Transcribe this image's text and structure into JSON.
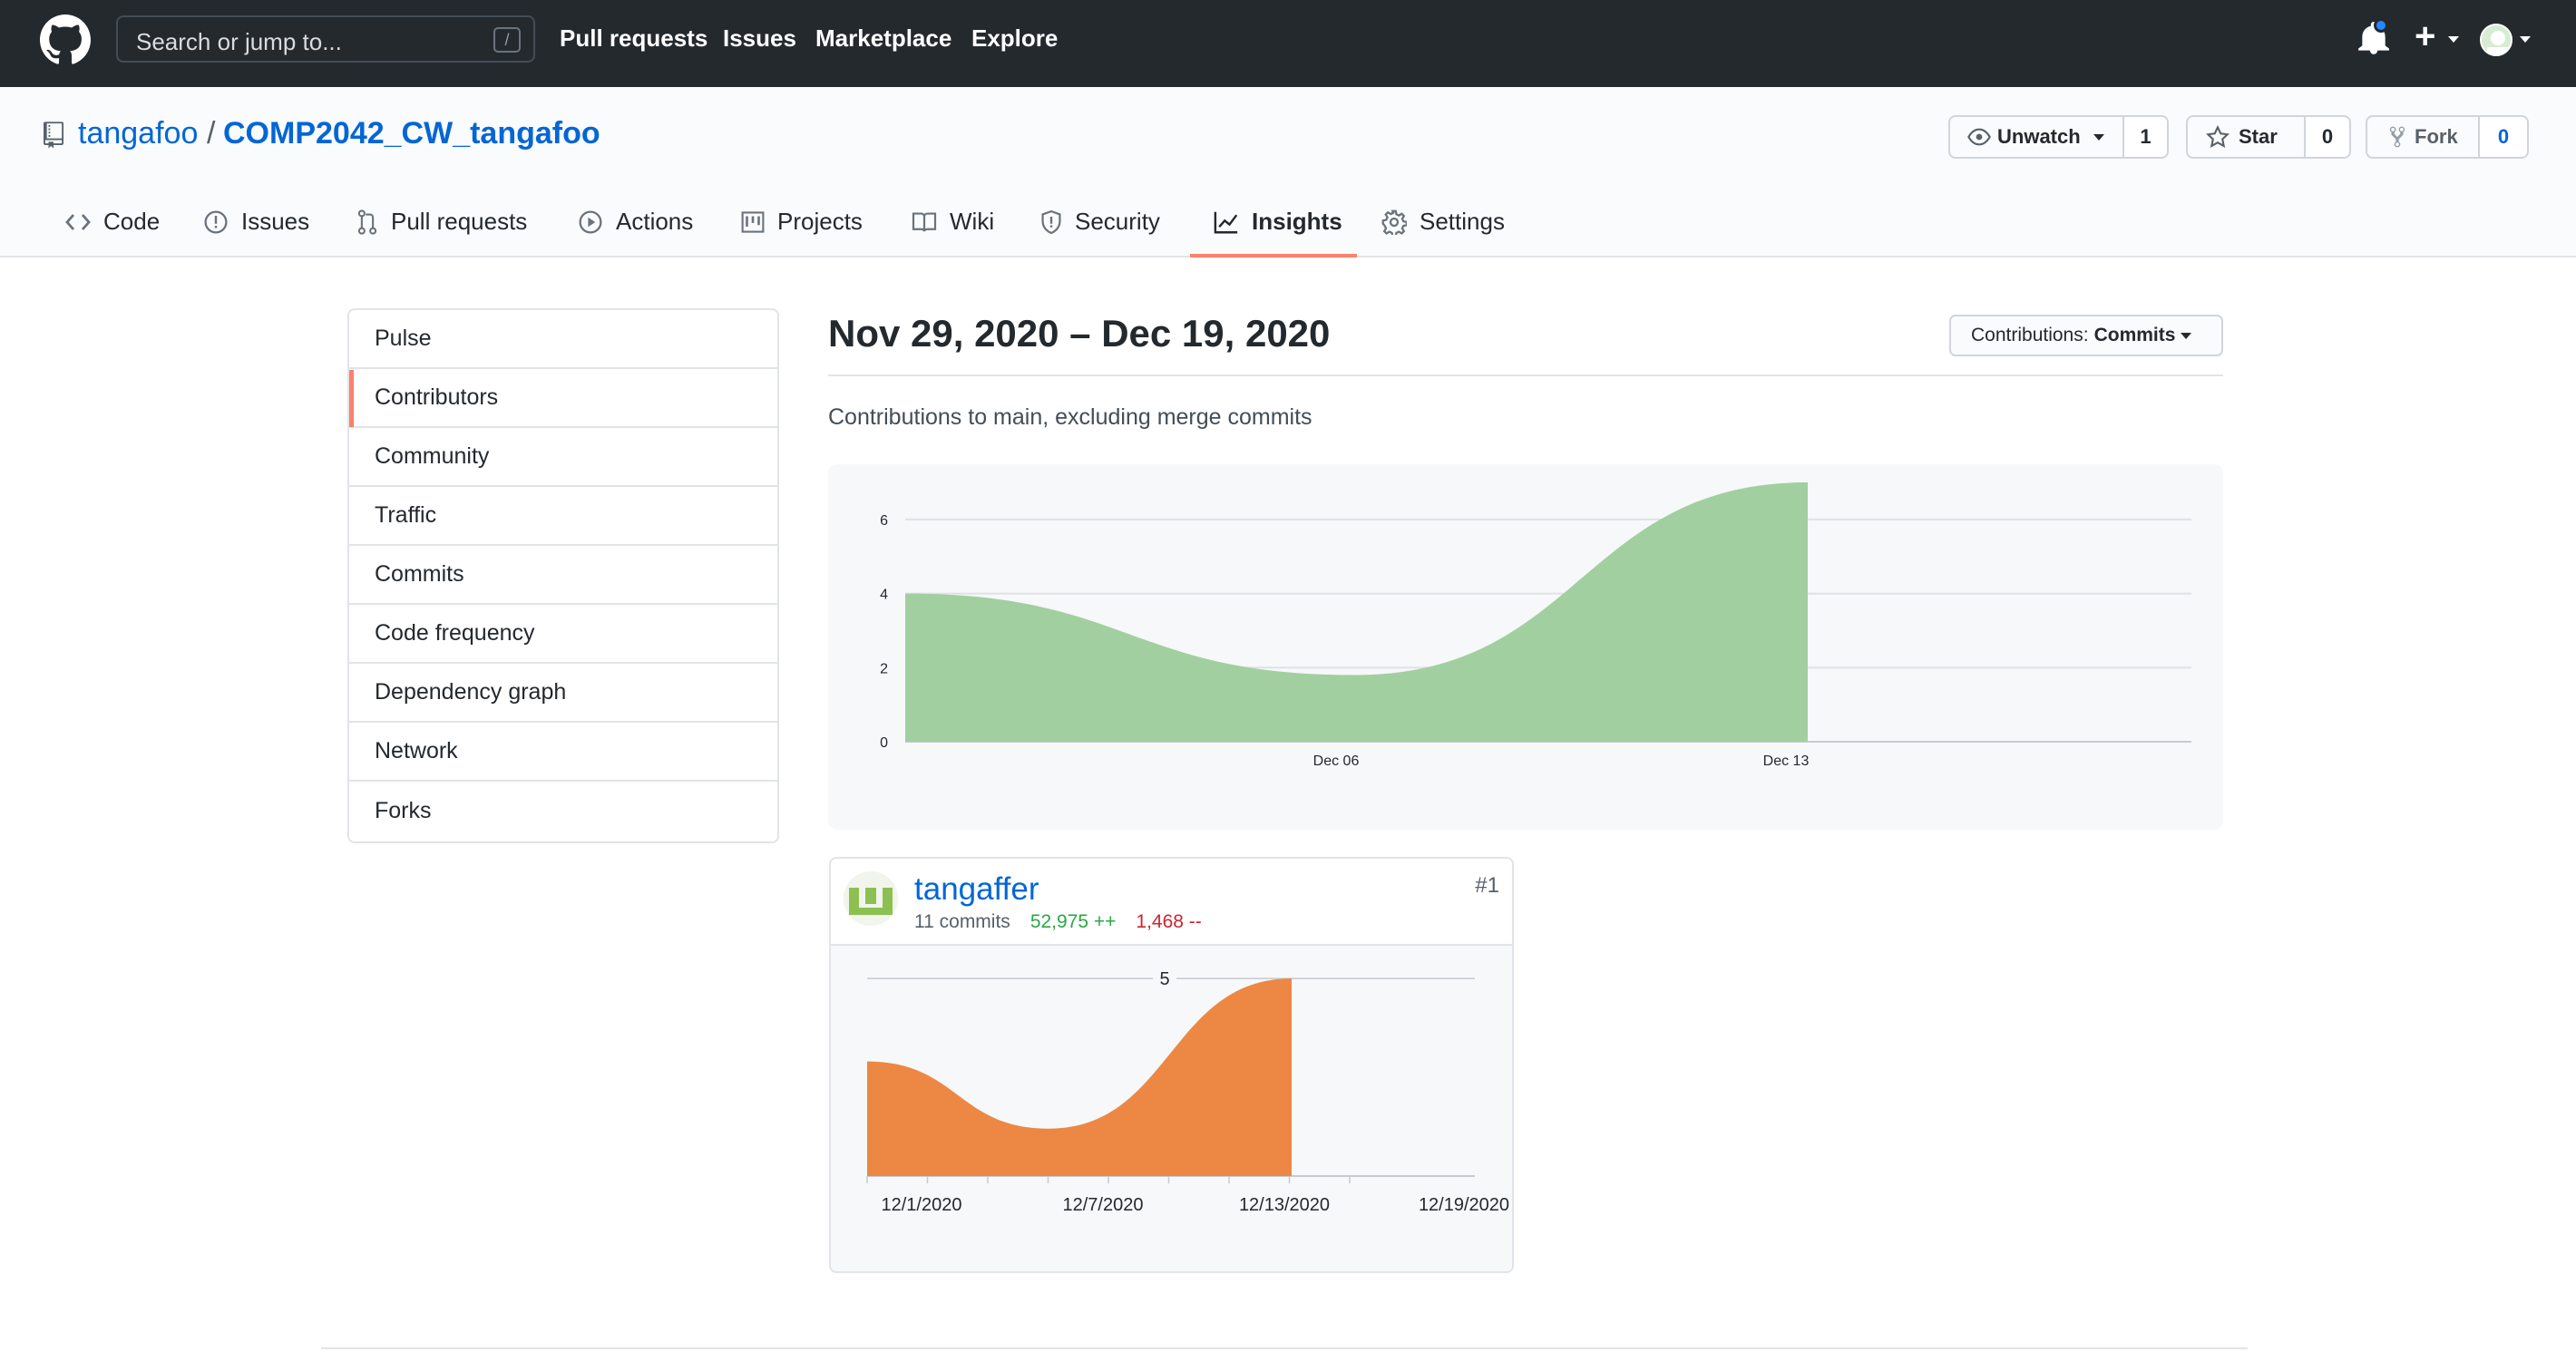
{
  "topbar": {
    "search_placeholder": "Search or jump to...",
    "search_shortcut": "/",
    "links": [
      "Pull requests",
      "Issues",
      "Marketplace",
      "Explore"
    ]
  },
  "repo": {
    "owner": "tangafoo",
    "separator": "/",
    "name": "COMP2042_CW_tangafoo",
    "watch_label": "Unwatch",
    "watch_count": "1",
    "star_label": "Star",
    "star_count": "0",
    "fork_label": "Fork",
    "fork_count": "0"
  },
  "tabs": [
    "Code",
    "Issues",
    "Pull requests",
    "Actions",
    "Projects",
    "Wiki",
    "Security",
    "Insights",
    "Settings"
  ],
  "active_tab": "Insights",
  "sidebar": {
    "items": [
      "Pulse",
      "Contributors",
      "Community",
      "Traffic",
      "Commits",
      "Code frequency",
      "Dependency graph",
      "Network",
      "Forks"
    ],
    "active": "Contributors"
  },
  "main": {
    "date_range": "Nov 29, 2020 – Dec 19, 2020",
    "contributions_label": "Contributions:",
    "contributions_value": "Commits",
    "subtitle": "Contributions to main, excluding merge commits"
  },
  "chart_data": [
    {
      "type": "area",
      "title": "",
      "x": [
        "Nov 29",
        "Dec 06",
        "Dec 13"
      ],
      "y_ticks": [
        0,
        2,
        4,
        6
      ],
      "x_tick_labels": [
        "Dec 06",
        "Dec 13"
      ],
      "series": [
        {
          "values": [
            4,
            1.8,
            7
          ],
          "color": "#a2cfa0"
        }
      ],
      "ylim": [
        0,
        7
      ],
      "grid": true
    },
    {
      "type": "area",
      "title": "",
      "x": [
        "12/1/2020",
        "12/7/2020",
        "12/13/2020"
      ],
      "x_tick_labels": [
        "12/1/2020",
        "12/7/2020",
        "12/13/2020",
        "12/19/2020"
      ],
      "y_ticks": [
        5
      ],
      "series": [
        {
          "values": [
            2.9,
            1.2,
            5
          ],
          "color": "#ec8844"
        }
      ],
      "ylim": [
        0,
        5.6
      ],
      "grid": true
    }
  ],
  "contributor": {
    "name": "tangaffer",
    "commits": "11 commits",
    "additions": "52,975 ++",
    "deletions": "1,468 --",
    "rank": "#1"
  }
}
